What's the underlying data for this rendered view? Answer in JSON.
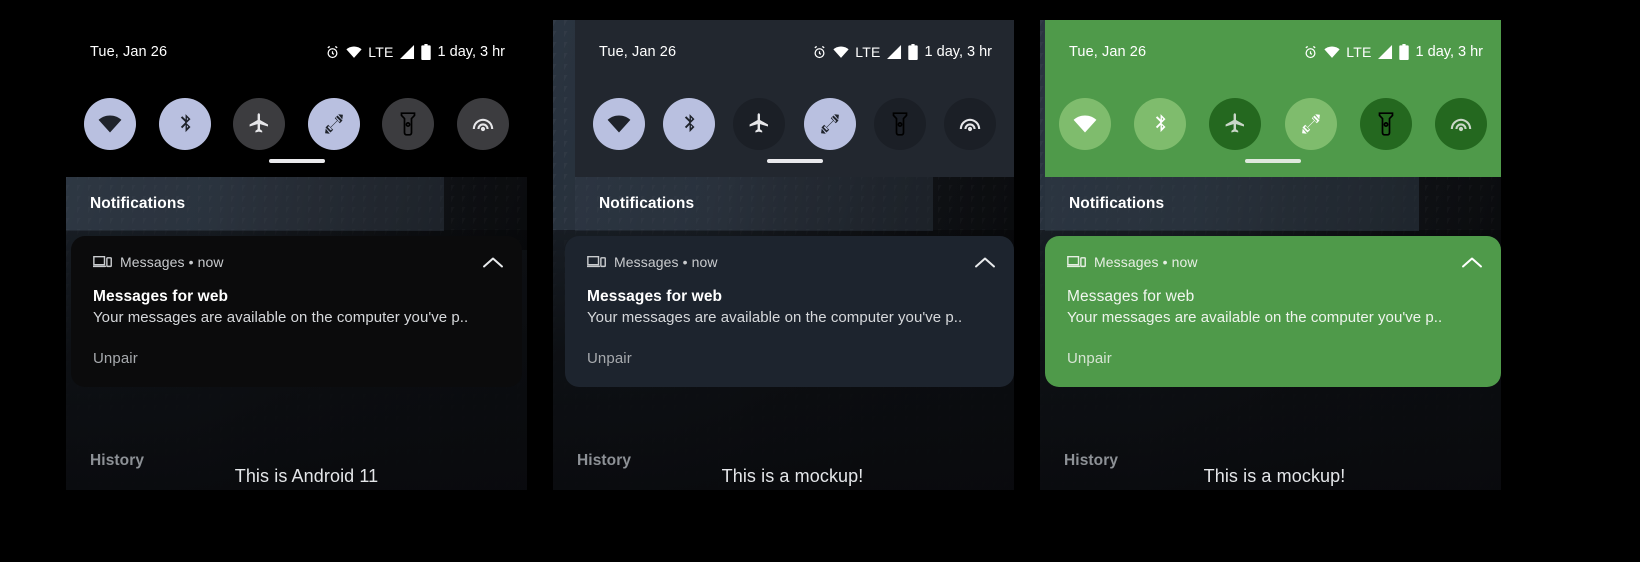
{
  "panels": [
    {
      "id": "panel-android11",
      "theme": "black",
      "statusbar": {
        "date": "Tue, Jan 26",
        "network_label": "LTE",
        "battery_text": "1 day, 3 hr",
        "icons": [
          "alarm-icon",
          "wifi-icon",
          "signal-icon",
          "battery-icon"
        ]
      },
      "tiles": [
        {
          "name": "wifi",
          "icon": "wifi-icon",
          "state": "on"
        },
        {
          "name": "bluetooth",
          "icon": "bluetooth-icon",
          "state": "on"
        },
        {
          "name": "airplane-mode",
          "icon": "airplane-icon",
          "state": "off"
        },
        {
          "name": "auto-rotate",
          "icon": "auto-rotate-icon",
          "state": "on"
        },
        {
          "name": "flashlight",
          "icon": "flashlight-icon",
          "state": "off"
        },
        {
          "name": "cast",
          "icon": "cast-icon",
          "state": "off"
        }
      ],
      "notifications_label": "Notifications",
      "notification": {
        "app": "Messages • now",
        "icon": "devices-icon",
        "collapse_icon": "chevron-up-icon",
        "title": "Messages for web",
        "body": "Your messages are available on the computer you've p..",
        "action": "Unpair"
      },
      "history_label": "History",
      "caption": "This is Android 11",
      "colors": {
        "shade_bg": "#000000",
        "tile_on": "#b9c0e0",
        "tile_off": "#3c3c3f",
        "card_bg": "#0b0b0c"
      }
    },
    {
      "id": "panel-dark-blue",
      "theme": "dark-blue",
      "statusbar": {
        "date": "Tue, Jan 26",
        "network_label": "LTE",
        "battery_text": "1 day, 3 hr",
        "icons": [
          "alarm-icon",
          "wifi-icon",
          "signal-icon",
          "battery-icon"
        ]
      },
      "tiles": [
        {
          "name": "wifi",
          "icon": "wifi-icon",
          "state": "on"
        },
        {
          "name": "bluetooth",
          "icon": "bluetooth-icon",
          "state": "on"
        },
        {
          "name": "airplane-mode",
          "icon": "airplane-icon",
          "state": "off"
        },
        {
          "name": "auto-rotate",
          "icon": "auto-rotate-icon",
          "state": "on"
        },
        {
          "name": "flashlight",
          "icon": "flashlight-icon",
          "state": "off"
        },
        {
          "name": "cast",
          "icon": "cast-icon",
          "state": "off"
        }
      ],
      "notifications_label": "Notifications",
      "notification": {
        "app": "Messages • now",
        "icon": "devices-icon",
        "collapse_icon": "chevron-up-icon",
        "title": "Messages for web",
        "body": "Your messages are available on the computer you've p..",
        "action": "Unpair"
      },
      "history_label": "History",
      "caption": "This is a mockup!",
      "colors": {
        "shade_bg": "#22272f",
        "tile_on": "#b9c0e0",
        "tile_off": "#1b1f26",
        "card_bg": "#1d242e"
      }
    },
    {
      "id": "panel-green",
      "theme": "green",
      "statusbar": {
        "date": "Tue, Jan 26",
        "network_label": "LTE",
        "battery_text": "1 day, 3 hr",
        "icons": [
          "alarm-icon",
          "wifi-icon",
          "signal-icon",
          "battery-icon"
        ]
      },
      "tiles": [
        {
          "name": "wifi",
          "icon": "wifi-icon",
          "state": "on"
        },
        {
          "name": "bluetooth",
          "icon": "bluetooth-icon",
          "state": "on"
        },
        {
          "name": "airplane-mode",
          "icon": "airplane-icon",
          "state": "off"
        },
        {
          "name": "auto-rotate",
          "icon": "auto-rotate-icon",
          "state": "on"
        },
        {
          "name": "flashlight",
          "icon": "flashlight-icon",
          "state": "off"
        },
        {
          "name": "cast",
          "icon": "cast-icon",
          "state": "off"
        }
      ],
      "notifications_label": "Notifications",
      "notification": {
        "app": "Messages • now",
        "icon": "devices-icon",
        "collapse_icon": "chevron-up-icon",
        "title": "Messages for web",
        "body": "Your messages are available on the computer you've p..",
        "action": "Unpair"
      },
      "history_label": "History",
      "caption": "This is a mockup!",
      "colors": {
        "shade_bg": "#4f9a4a",
        "tile_on": "#7fbc6d",
        "tile_off": "#24681f",
        "card_bg": "#4f9a4a"
      }
    }
  ]
}
